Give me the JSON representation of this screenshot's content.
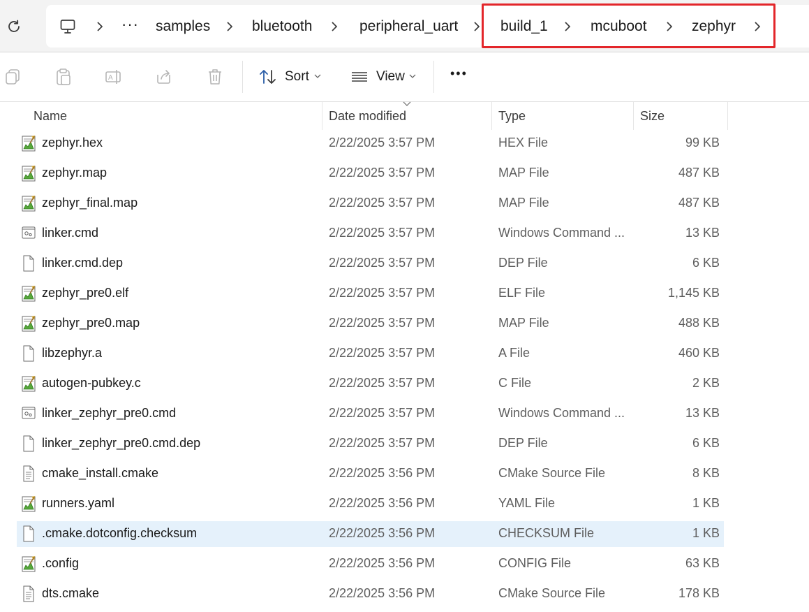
{
  "breadcrumb": {
    "ellipsis": "···",
    "items": [
      "samples",
      "bluetooth",
      "peripheral_uart",
      "build_1",
      "mcuboot",
      "zephyr"
    ]
  },
  "toolbar": {
    "sort_label": "Sort",
    "view_label": "View",
    "more_label": "•••"
  },
  "columns": {
    "name": "Name",
    "date": "Date modified",
    "type": "Type",
    "size": "Size"
  },
  "files": [
    {
      "name": "zephyr.hex",
      "date": "2/22/2025 3:57 PM",
      "type": "HEX File",
      "size": "99 KB",
      "icon": "notepad-plus-icon"
    },
    {
      "name": "zephyr.map",
      "date": "2/22/2025 3:57 PM",
      "type": "MAP File",
      "size": "487 KB",
      "icon": "notepad-plus-icon"
    },
    {
      "name": "zephyr_final.map",
      "date": "2/22/2025 3:57 PM",
      "type": "MAP File",
      "size": "487 KB",
      "icon": "notepad-plus-icon"
    },
    {
      "name": "linker.cmd",
      "date": "2/22/2025 3:57 PM",
      "type": "Windows Command ...",
      "size": "13 KB",
      "icon": "cmd-file-icon"
    },
    {
      "name": "linker.cmd.dep",
      "date": "2/22/2025 3:57 PM",
      "type": "DEP File",
      "size": "6 KB",
      "icon": "blank-file-icon"
    },
    {
      "name": "zephyr_pre0.elf",
      "date": "2/22/2025 3:57 PM",
      "type": "ELF File",
      "size": "1,145 KB",
      "icon": "notepad-plus-icon"
    },
    {
      "name": "zephyr_pre0.map",
      "date": "2/22/2025 3:57 PM",
      "type": "MAP File",
      "size": "488 KB",
      "icon": "notepad-plus-icon"
    },
    {
      "name": "libzephyr.a",
      "date": "2/22/2025 3:57 PM",
      "type": "A File",
      "size": "460 KB",
      "icon": "blank-file-icon"
    },
    {
      "name": "autogen-pubkey.c",
      "date": "2/22/2025 3:57 PM",
      "type": "C File",
      "size": "2 KB",
      "icon": "notepad-plus-icon"
    },
    {
      "name": "linker_zephyr_pre0.cmd",
      "date": "2/22/2025 3:57 PM",
      "type": "Windows Command ...",
      "size": "13 KB",
      "icon": "cmd-file-icon"
    },
    {
      "name": "linker_zephyr_pre0.cmd.dep",
      "date": "2/22/2025 3:57 PM",
      "type": "DEP File",
      "size": "6 KB",
      "icon": "blank-file-icon"
    },
    {
      "name": "cmake_install.cmake",
      "date": "2/22/2025 3:56 PM",
      "type": "CMake Source File",
      "size": "8 KB",
      "icon": "text-file-icon"
    },
    {
      "name": "runners.yaml",
      "date": "2/22/2025 3:56 PM",
      "type": "YAML File",
      "size": "1 KB",
      "icon": "notepad-plus-icon"
    },
    {
      "name": ".cmake.dotconfig.checksum",
      "date": "2/22/2025 3:56 PM",
      "type": "CHECKSUM File",
      "size": "1 KB",
      "icon": "blank-file-icon",
      "selected": true
    },
    {
      "name": ".config",
      "date": "2/22/2025 3:56 PM",
      "type": "CONFIG File",
      "size": "63 KB",
      "icon": "notepad-plus-icon"
    },
    {
      "name": "dts.cmake",
      "date": "2/22/2025 3:56 PM",
      "type": "CMake Source File",
      "size": "178 KB",
      "icon": "text-file-icon"
    }
  ],
  "colors": {
    "highlight_border": "#e3262a",
    "selected_row": "#e5f1fb",
    "secondary_text": "#5e5e5e"
  }
}
